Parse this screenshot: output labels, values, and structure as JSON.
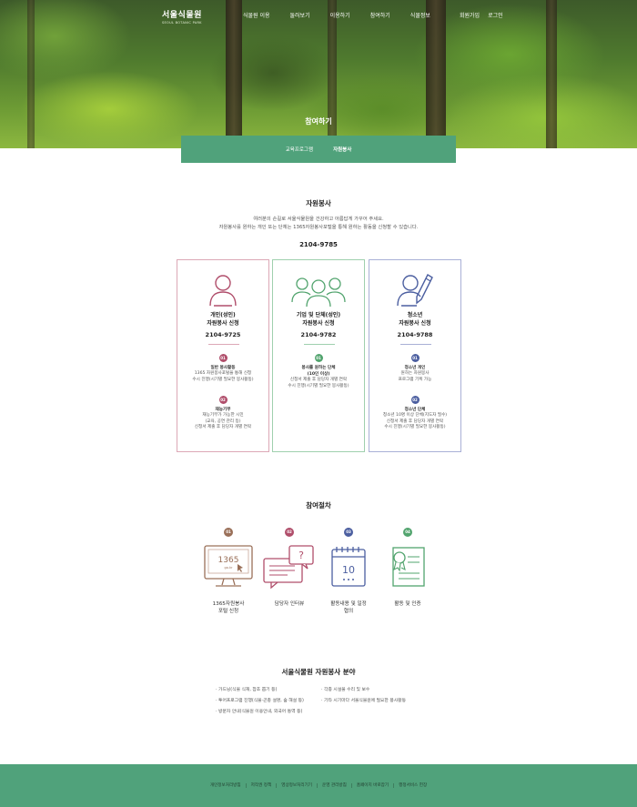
{
  "header": {
    "logo": "서울식물원",
    "logo_sub": "SEOUL BOTANIC PARK",
    "menu": [
      "식물원 이용",
      "둘러보기",
      "이용하기",
      "참여하기",
      "식물정보"
    ],
    "util": [
      "회원가입",
      "로그인"
    ],
    "page_title": "참여하기"
  },
  "tabs": [
    "교육프로그램",
    "자원봉사"
  ],
  "volunteer": {
    "title": "자원봉사",
    "intro_1": "여러분의 손길로 서울식물원을 건강하고 아름답게 가꾸어 주세요.",
    "intro_2": "자원봉사를 원하는 개인 또는 단체는 1365자원봉사포털을 통해 원하는 활동을 신청할 수 있습니다.",
    "phone": "2104-9785",
    "cards": [
      {
        "title_1": "개인(성인)",
        "title_2": "자원봉사 신청",
        "phone": "2104-9725",
        "subs": [
          {
            "num": "01",
            "head": "일반 봉사활동",
            "body": [
              "1365 자원봉사포털을 통해 신청",
              "수시 진행(시기별 필요한 봉사활동)"
            ]
          },
          {
            "num": "02",
            "head": "재능기부",
            "body": [
              "재능기부가 가능한 시민",
              "(교육, 공연 관리 등)",
              "신청서 제출 후 담당자 개별 연락"
            ]
          }
        ]
      },
      {
        "title_1": "기업 및 단체(성인)",
        "title_2": "자원봉사 신청",
        "phone": "2104-9782",
        "subs": [
          {
            "num": "01",
            "head": "봉사를 원하는 단체",
            "head_2": "(10인 이상)",
            "body": [
              "신청서 제출 후 담당자 개별 연락",
              "수시 진행(시기별 필요한 봉사활동)"
            ]
          }
        ]
      },
      {
        "title_1": "청소년",
        "title_2": "자원봉사 신청",
        "phone": "2104-9788",
        "subs": [
          {
            "num": "01",
            "head": "청소년 개인",
            "body": [
              "원하는 자원봉사",
              "프로그램 기획 가능"
            ]
          },
          {
            "num": "02",
            "head": "청소년 단체",
            "body": [
              "청소년 10명 이상 단체(지도자 필수)",
              "신청서 제출 후 담당자 개별 연락",
              "수시 진행(시기별 필요한 봉사활동)"
            ]
          }
        ]
      }
    ]
  },
  "process": {
    "title": "참여절차",
    "screen_text": "1365",
    "screen_sub": "go.kr",
    "calendar_text": "10",
    "steps": [
      {
        "num": "01",
        "label_1": "1365자원봉사",
        "label_2": "포털 신청"
      },
      {
        "num": "02",
        "label_1": "담당자 인터뷰",
        "label_2": ""
      },
      {
        "num": "03",
        "label_1": "활동내용 및 일정",
        "label_2": "협의"
      },
      {
        "num": "04",
        "label_1": "활동 및 인증",
        "label_2": ""
      }
    ]
  },
  "fields": {
    "title": "서울식물원 자원봉사 분야",
    "left": [
      "· 가드닝(식물 식재, 잡초 뽑기 등)",
      "· 투어프로그램 진행(식물·곤충 설명, 숲 해설 등)",
      "· 방문자 안내(식물원 이용안내, 외국어 통역 등)"
    ],
    "right": [
      "· 각종 시설물 수리 및 보수",
      "· 기타 시기마다 서울식물원에 필요한 봉사활동"
    ]
  },
  "footer": {
    "links": [
      "개인정보처리방침",
      "저작권 정책",
      "영상정보처리기기",
      "운영 관리방침",
      "홈페이지 바로잡기",
      "행정서비스 헌장"
    ]
  },
  "colors": {
    "green": "#50a27b",
    "pink": "#b04e6b",
    "teal": "#52a46e",
    "purple": "#4c5fa0",
    "brown": "#9a7059"
  }
}
